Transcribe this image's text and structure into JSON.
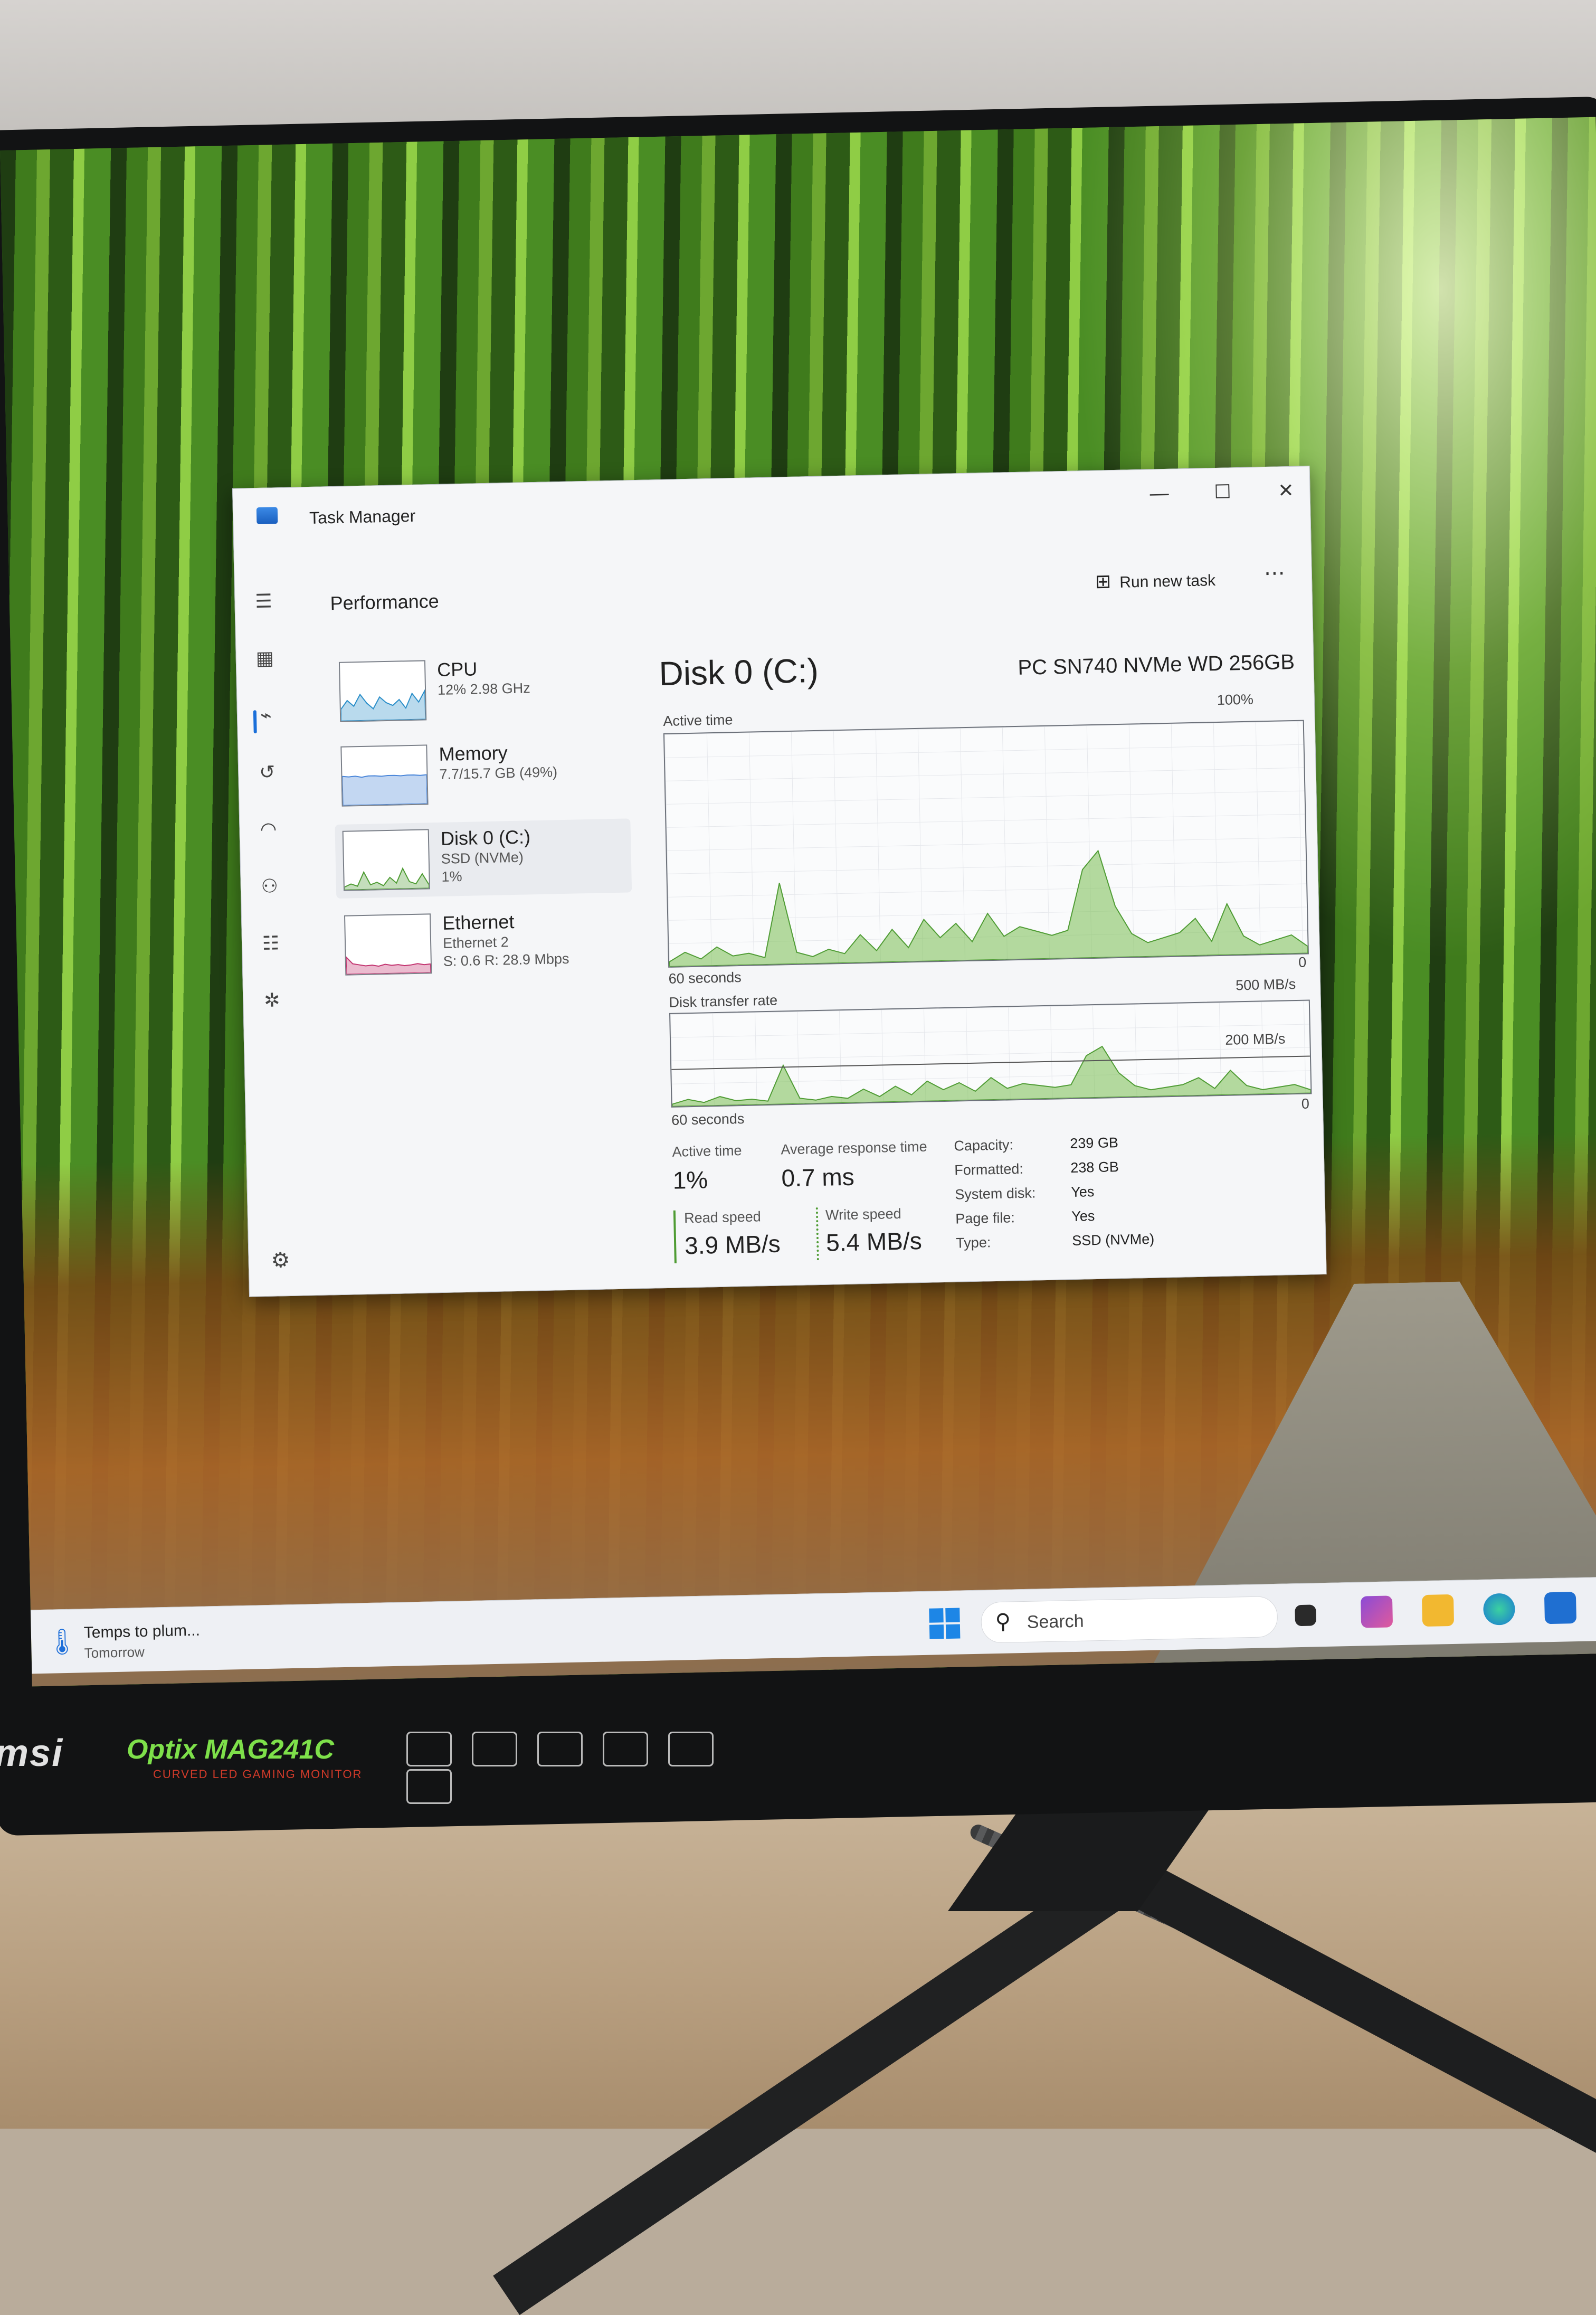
{
  "window": {
    "title": "Task Manager",
    "page": "Performance",
    "run_new_task": "Run new task",
    "controls": [
      "—",
      "☐",
      "✕"
    ]
  },
  "nav_icons": [
    "hamburger-icon",
    "processes-icon",
    "performance-icon",
    "app-history-icon",
    "startup-apps-icon",
    "users-icon",
    "details-icon",
    "services-icon",
    "settings-icon"
  ],
  "resources": [
    {
      "name": "CPU",
      "line1": "12% 2.98 GHz",
      "line2": "",
      "color": "#2c8fc9"
    },
    {
      "name": "Memory",
      "line1": "7.7/15.7 GB (49%)",
      "line2": "",
      "color": "#4a86d9"
    },
    {
      "name": "Disk 0 (C:)",
      "line1": "SSD (NVMe)",
      "line2": "1%",
      "color": "#4f9c34"
    },
    {
      "name": "Ethernet",
      "line1": "Ethernet 2",
      "line2": "S: 0.6 R: 28.9 Mbps",
      "color": "#c2336f"
    }
  ],
  "disk": {
    "title": "Disk 0 (C:)",
    "model": "PC SN740 NVMe WD 256GB",
    "active_time_label": "Active time",
    "active_time_max": "100%",
    "graph1_span": "60 seconds",
    "graph1_min": "0",
    "transfer_label": "Disk transfer rate",
    "transfer_max": "500 MB/s",
    "transfer_ref": "200 MB/s",
    "graph2_span": "60 seconds",
    "graph2_min": "0",
    "stats": {
      "active_time_label": "Active time",
      "active_time_value": "1%",
      "avg_response_label": "Average response time",
      "avg_response_value": "0.7 ms",
      "read_label": "Read speed",
      "read_value": "3.9 MB/s",
      "write_label": "Write speed",
      "write_value": "5.4 MB/s"
    },
    "properties": [
      {
        "key": "Capacity:",
        "value": "239 GB"
      },
      {
        "key": "Formatted:",
        "value": "238 GB"
      },
      {
        "key": "System disk:",
        "value": "Yes"
      },
      {
        "key": "Page file:",
        "value": "Yes"
      },
      {
        "key": "Type:",
        "value": "SSD (NVMe)"
      }
    ]
  },
  "taskbar": {
    "weather_title": "Temps to plum...",
    "weather_sub": "Tomorrow",
    "search_placeholder": "Search"
  },
  "monitor": {
    "brand": "msi",
    "model": "Optix MAG241C",
    "subtitle": "CURVED LED GAMING MONITOR"
  }
}
